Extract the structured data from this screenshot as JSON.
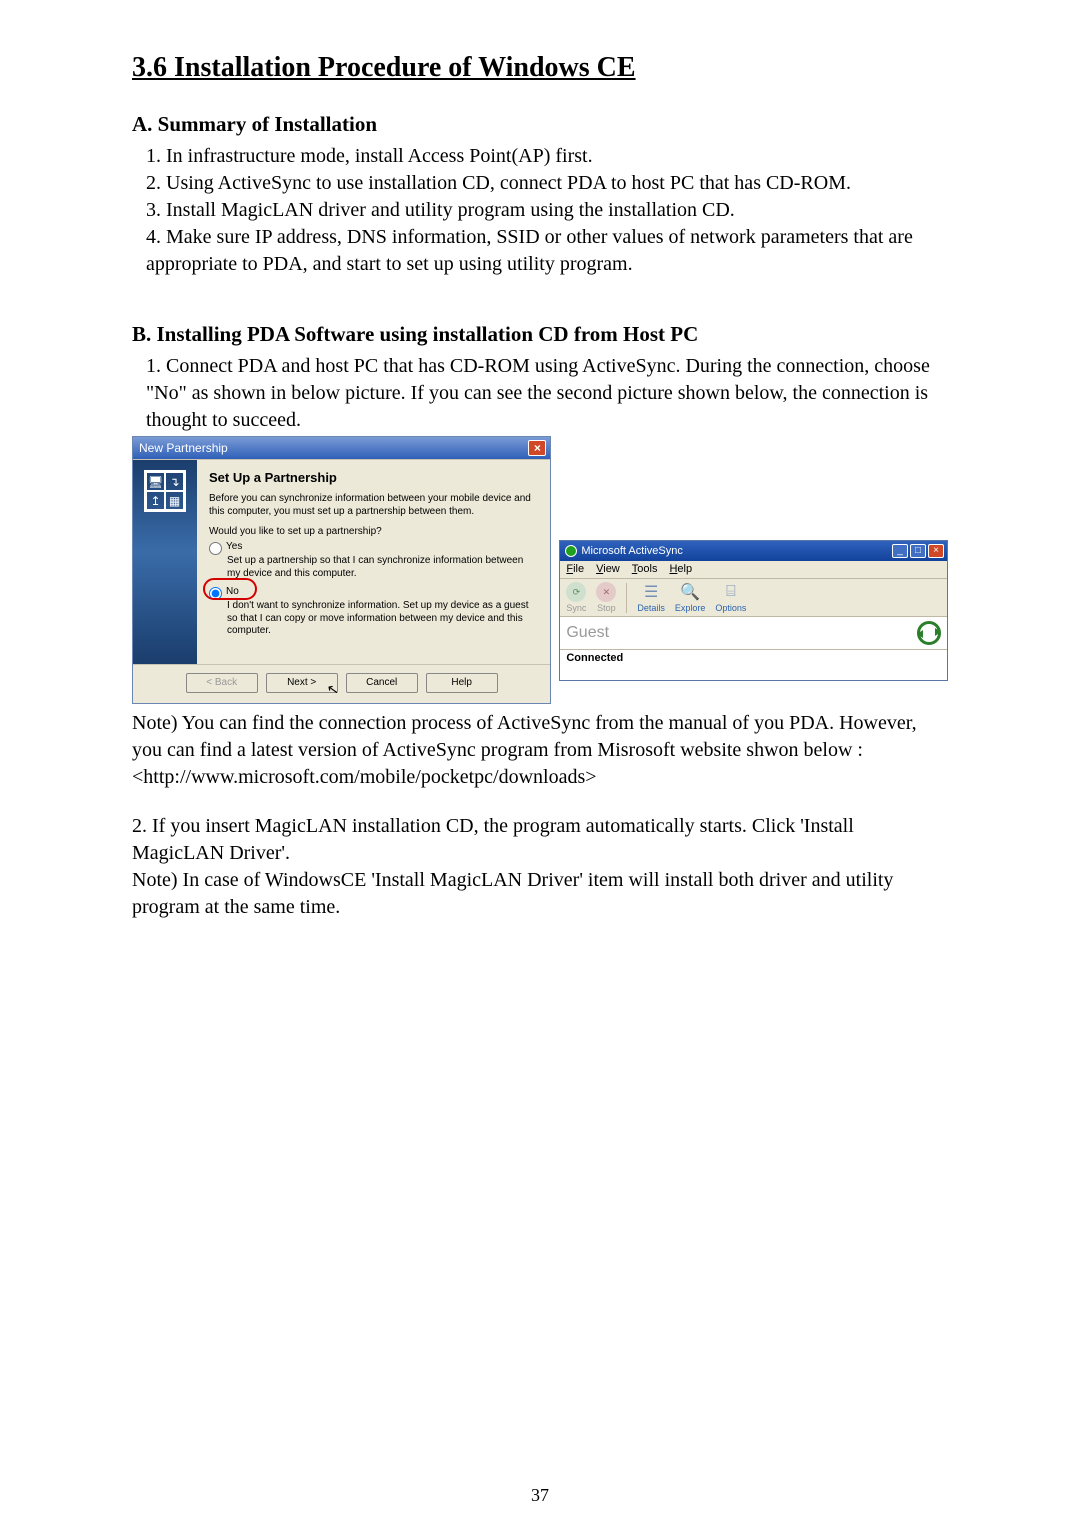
{
  "title": "3.6 Installation Procedure of Windows CE",
  "sectionA": {
    "heading": "A. Summary of Installation",
    "items": [
      "1. In infrastructure mode, install Access Point(AP) first.",
      "2. Using ActiveSync to use installation CD, connect PDA to host PC that has CD-ROM.",
      "3. Install MagicLAN driver and utility program using the installation CD.",
      "4. Make sure IP address, DNS information, SSID or other values of network parameters that are appropriate to PDA, and start to set up using utility program."
    ]
  },
  "sectionB": {
    "heading": "B. Installing PDA Software using installation CD from Host PC",
    "intro": "1. Connect PDA and host PC that has CD-ROM using ActiveSync. During the connection, choose \"No\" as shown in below picture. If you can see the second picture shown below, the connection is thought to succeed."
  },
  "npDialog": {
    "windowTitle": "New Partnership",
    "heading": "Set Up a Partnership",
    "desc": "Before you can synchronize information between your mobile device and this computer, you must set up a partnership between them.",
    "question": "Would you like to set up a partnership?",
    "yesLabel": "Yes",
    "yesDesc": "Set up a partnership so that I can synchronize information between my device and this computer.",
    "noLabel": "No",
    "noDesc": "I don't want to synchronize information. Set up my device as a guest so that I can copy or move information between my device and this computer.",
    "buttons": {
      "back": "< Back",
      "next": "Next >",
      "cancel": "Cancel",
      "help": "Help"
    }
  },
  "asWindow": {
    "title": "Microsoft ActiveSync",
    "menu": {
      "file": "File",
      "view": "View",
      "tools": "Tools",
      "help": "Help"
    },
    "toolbar": {
      "sync": "Sync",
      "stop": "Stop",
      "details": "Details",
      "explore": "Explore",
      "options": "Options"
    },
    "statusTop": "Guest",
    "statusBottom": "Connected"
  },
  "afterShots": {
    "note1": "Note) You can find the connection process of ActiveSync from the manual of you PDA. However, you can find a latest version of ActiveSync program from Misrosoft website shwon below :",
    "url": "<http://www.microsoft.com/mobile/pocketpc/downloads>",
    "p2": "2. If you insert MagicLAN installation CD, the program automatically starts. Click 'Install MagicLAN Driver'.",
    "note2": "Note) In case of WindowsCE 'Install MagicLAN Driver' item will install both driver and utility program at the same time."
  },
  "pageNumber": "37"
}
